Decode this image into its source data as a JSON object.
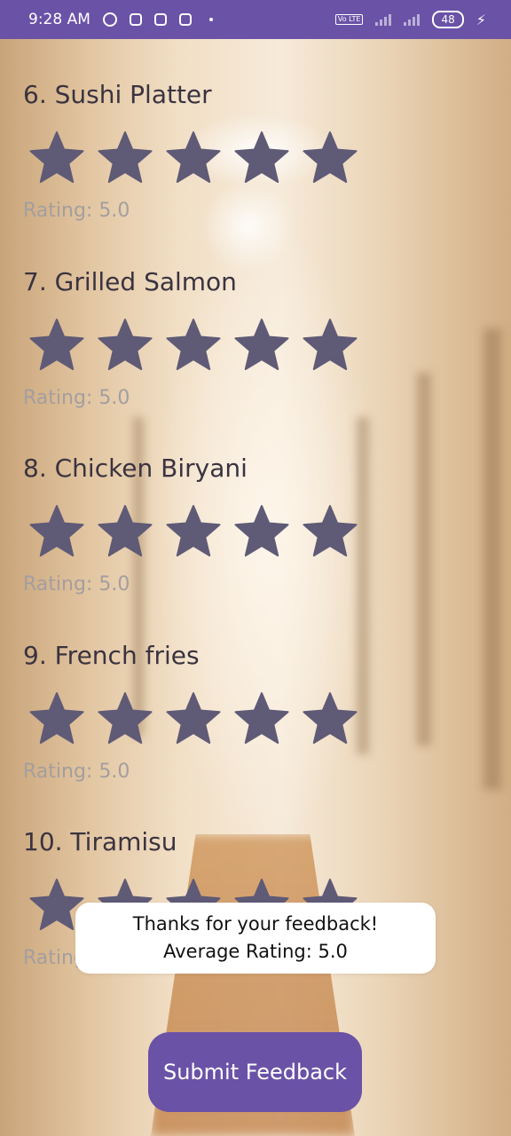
{
  "status_bar": {
    "time": "9:28 AM",
    "battery": "48",
    "network_badge": "Vo LTE"
  },
  "items": [
    {
      "title": "6. Sushi Platter",
      "rating_label": "Rating: 5.0",
      "stars_filled": 5
    },
    {
      "title": "7. Grilled Salmon",
      "rating_label": "Rating: 5.0",
      "stars_filled": 5
    },
    {
      "title": "8. Chicken Biryani",
      "rating_label": "Rating: 5.0",
      "stars_filled": 5
    },
    {
      "title": "9. French fries",
      "rating_label": "Rating: 5.0",
      "stars_filled": 5
    },
    {
      "title": "10. Tiramisu",
      "rating_label": "Rating: 5.0",
      "stars_filled": 5
    }
  ],
  "toast": {
    "line1": "Thanks for your feedback!",
    "line2": "Average Rating: 5.0"
  },
  "submit_label": "Submit Feedback",
  "colors": {
    "accent": "#6a52a7",
    "star": "#5f5a76",
    "title": "#3a3340",
    "rating_label": "#a39e9f"
  },
  "icons": [
    "alarm-icon",
    "chat-icon",
    "message-icon",
    "notification-icon",
    "signal-icon",
    "battery-icon",
    "charging-icon",
    "star-icon"
  ]
}
